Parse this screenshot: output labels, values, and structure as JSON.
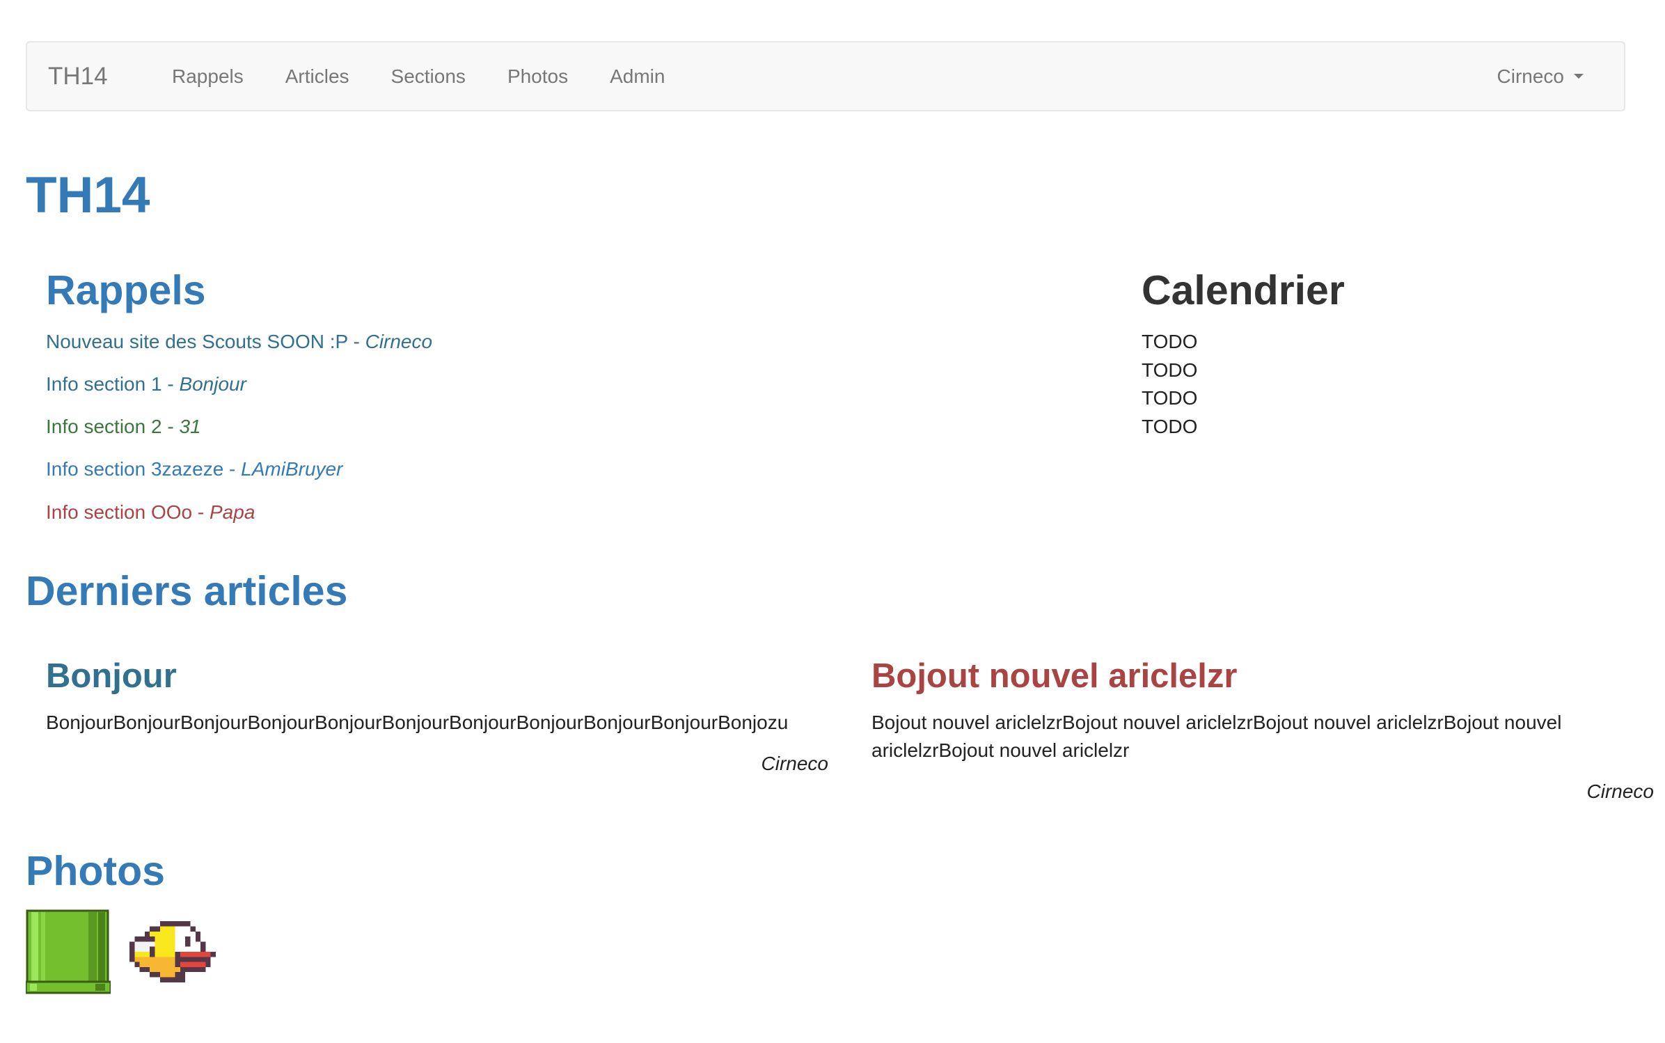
{
  "navbar": {
    "brand": "TH14",
    "links": [
      "Rappels",
      "Articles",
      "Sections",
      "Photos",
      "Admin"
    ],
    "user": "Cirneco"
  },
  "site_title": "TH14",
  "rappels": {
    "heading": "Rappels",
    "items": [
      {
        "text": "Nouveau site des Scouts SOON :P - ",
        "author": "Cirneco",
        "color": "#31708f"
      },
      {
        "text": "Info section 1 - ",
        "author": "Bonjour",
        "color": "#31708f"
      },
      {
        "text": "Info section 2 - ",
        "author": "31",
        "color": "#3c763d"
      },
      {
        "text": "Info section 3zazeze - ",
        "author": "LAmiBruyer",
        "color": "#337ab7"
      },
      {
        "text": "Info section OOo - ",
        "author": "Papa",
        "color": "#a94442"
      }
    ]
  },
  "calendar": {
    "heading": "Calendrier",
    "items": [
      "TODO",
      "TODO",
      "TODO",
      "TODO"
    ]
  },
  "articles": {
    "heading": "Derniers articles",
    "items": [
      {
        "title": "Bonjour",
        "body": "BonjourBonjourBonjourBonjourBonjourBonjourBonjourBonjourBonjourBonjourBonjozu",
        "author": "Cirneco",
        "color": "#31708f"
      },
      {
        "title": "Bojout nouvel ariclelzr",
        "body": "Bojout nouvel ariclelzrBojout nouvel ariclelzrBojout nouvel ariclelzrBojout nouvel ariclelzrBojout nouvel ariclelzr",
        "author": "Cirneco",
        "color": "#a94442"
      }
    ]
  },
  "photos": {
    "heading": "Photos",
    "items": [
      "pipe-photo",
      "bird-photo"
    ]
  }
}
